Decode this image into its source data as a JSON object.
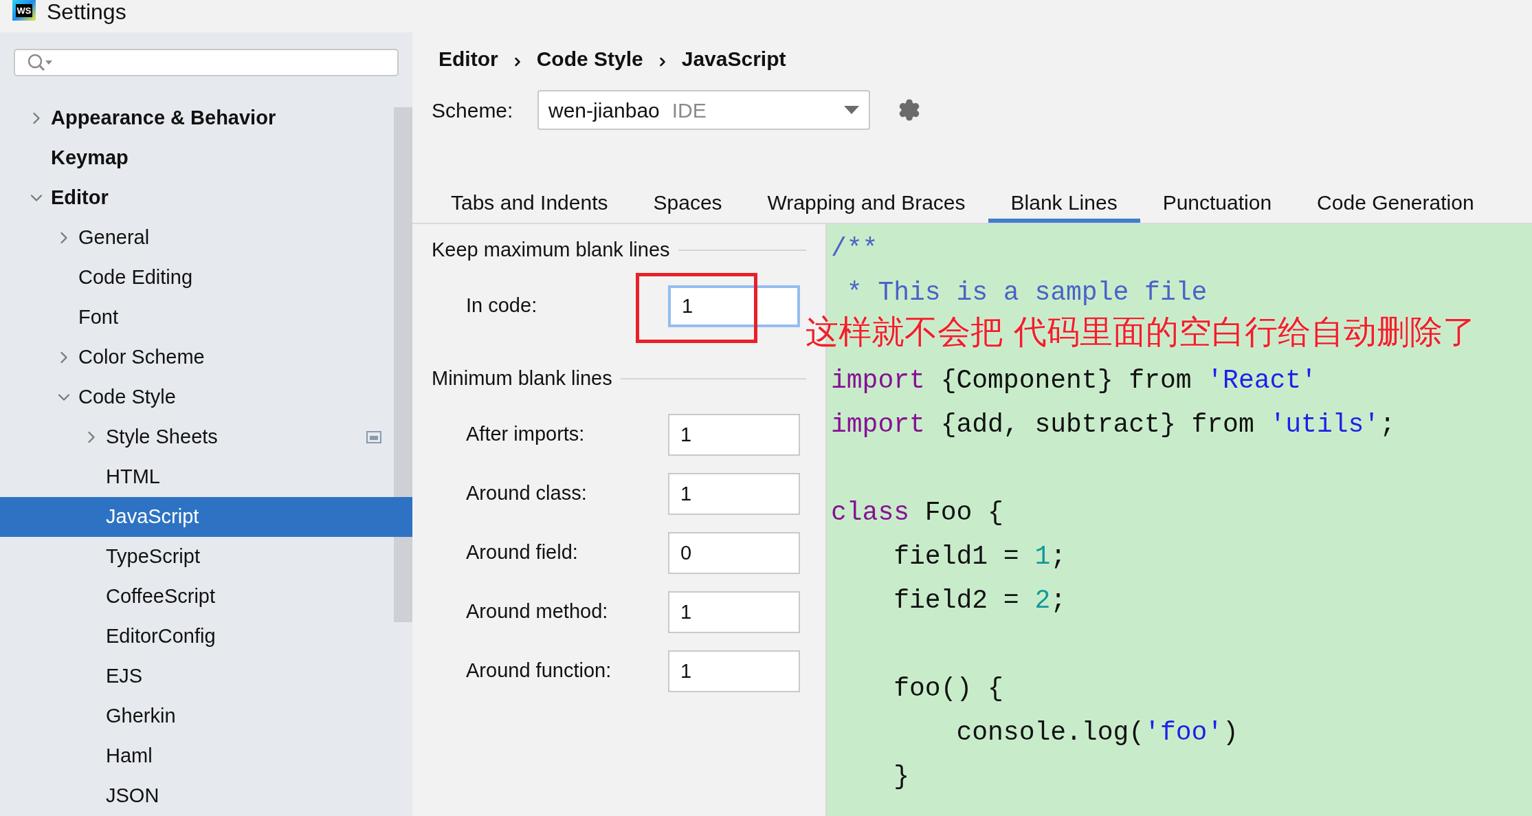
{
  "window": {
    "icon_text": "WS",
    "title": "Settings"
  },
  "sidebar": {
    "tree": [
      {
        "label": "Appearance & Behavior",
        "expanded": false,
        "selected": false
      },
      {
        "label": "Keymap",
        "selected": false
      },
      {
        "label": "Editor",
        "expanded": true,
        "selected": false,
        "children": [
          {
            "label": "General",
            "expanded": false,
            "selected": false
          },
          {
            "label": "Code Editing",
            "selected": false
          },
          {
            "label": "Font",
            "selected": false
          },
          {
            "label": "Color Scheme",
            "expanded": false,
            "selected": false
          },
          {
            "label": "Code Style",
            "expanded": true,
            "selected": false,
            "children": [
              {
                "label": "Style Sheets",
                "expanded": false,
                "selected": false,
                "scoped": true
              },
              {
                "label": "HTML",
                "selected": false,
                "scoped": false
              },
              {
                "label": "JavaScript",
                "selected": true,
                "scoped": false
              },
              {
                "label": "TypeScript",
                "selected": false,
                "scoped": false
              },
              {
                "label": "CoffeeScript",
                "selected": false,
                "scoped": false
              },
              {
                "label": "EditorConfig",
                "selected": false,
                "scoped": false
              },
              {
                "label": "EJS",
                "selected": false,
                "scoped": false
              },
              {
                "label": "Gherkin",
                "selected": false,
                "scoped": false
              },
              {
                "label": "Haml",
                "selected": false,
                "scoped": false
              },
              {
                "label": "JSON",
                "selected": false,
                "scoped": false
              }
            ]
          }
        ]
      }
    ]
  },
  "breadcrumb": [
    "Editor",
    "Code Style",
    "JavaScript"
  ],
  "scheme": {
    "label": "Scheme:",
    "value": "wen-jianbao",
    "tag": "IDE"
  },
  "tabs": [
    {
      "label": "Tabs and Indents",
      "selected": false
    },
    {
      "label": "Spaces",
      "selected": false
    },
    {
      "label": "Wrapping and Braces",
      "selected": false
    },
    {
      "label": "Blank Lines",
      "selected": true
    },
    {
      "label": "Punctuation",
      "selected": false
    },
    {
      "label": "Code Generation",
      "selected": false
    }
  ],
  "sections": [
    {
      "title": "Keep maximum blank lines",
      "fields": [
        {
          "label": "In code:",
          "value": "1",
          "focused": true
        }
      ]
    },
    {
      "title": "Minimum blank lines",
      "fields": [
        {
          "label": "After imports:",
          "value": "1",
          "focused": false
        },
        {
          "label": "Around class:",
          "value": "1",
          "focused": false
        },
        {
          "label": "Around field:",
          "value": "0",
          "focused": false
        },
        {
          "label": "Around method:",
          "value": "1",
          "focused": false
        },
        {
          "label": "Around function:",
          "value": "1",
          "focused": false
        }
      ]
    }
  ],
  "code_blocks": [
    [
      [
        {
          "text": "/**",
          "kind": "comment"
        }
      ],
      [
        {
          "text": " * This is a sample file",
          "kind": "comment"
        }
      ]
    ],
    [
      [
        {
          "text": "import",
          "kind": "keyword"
        },
        {
          "text": " {Component} from ",
          "kind": "plain"
        },
        {
          "text": "'React'",
          "kind": "string"
        }
      ],
      [
        {
          "text": "import",
          "kind": "keyword"
        },
        {
          "text": " {add, subtract} from ",
          "kind": "plain"
        },
        {
          "text": "'utils'",
          "kind": "string"
        },
        {
          "text": ";",
          "kind": "plain"
        }
      ]
    ],
    [
      [
        {
          "text": "class",
          "kind": "keyword"
        },
        {
          "text": " Foo {",
          "kind": "plain"
        }
      ],
      [
        {
          "text": "    field1 = ",
          "kind": "plain"
        },
        {
          "text": "1",
          "kind": "number"
        },
        {
          "text": ";",
          "kind": "plain"
        }
      ],
      [
        {
          "text": "    field2 = ",
          "kind": "plain"
        },
        {
          "text": "2",
          "kind": "number"
        },
        {
          "text": ";",
          "kind": "plain"
        }
      ]
    ],
    [
      [
        {
          "text": "    foo() {",
          "kind": "plain"
        }
      ],
      [
        {
          "text": "        console.log(",
          "kind": "plain"
        },
        {
          "text": "'foo'",
          "kind": "string"
        },
        {
          "text": ")",
          "kind": "plain"
        }
      ],
      [
        {
          "text": "    }",
          "kind": "plain"
        }
      ]
    ]
  ],
  "annotation": {
    "text": "这样就不会把 代码里面的空白行给自动删除了"
  }
}
